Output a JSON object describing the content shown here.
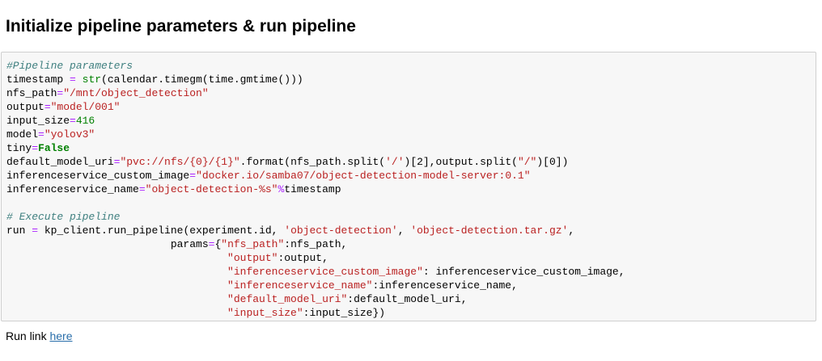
{
  "heading": "Initialize pipeline parameters & run pipeline",
  "code_cell": {
    "lines": [
      [
        {
          "t": "#Pipeline parameters",
          "k": "comment"
        }
      ],
      [
        {
          "t": "timestamp ",
          "k": "plain"
        },
        {
          "t": "=",
          "k": "op"
        },
        {
          "t": " ",
          "k": "plain"
        },
        {
          "t": "str",
          "k": "builtin"
        },
        {
          "t": "(calendar.timegm(time.gmtime()))",
          "k": "plain"
        }
      ],
      [
        {
          "t": "nfs_path",
          "k": "plain"
        },
        {
          "t": "=",
          "k": "op"
        },
        {
          "t": "\"/mnt/object_detection\"",
          "k": "string"
        }
      ],
      [
        {
          "t": "output",
          "k": "plain"
        },
        {
          "t": "=",
          "k": "op"
        },
        {
          "t": "\"model/001\"",
          "k": "string"
        }
      ],
      [
        {
          "t": "input_size",
          "k": "plain"
        },
        {
          "t": "=",
          "k": "op"
        },
        {
          "t": "416",
          "k": "number"
        }
      ],
      [
        {
          "t": "model",
          "k": "plain"
        },
        {
          "t": "=",
          "k": "op"
        },
        {
          "t": "\"yolov3\"",
          "k": "string"
        }
      ],
      [
        {
          "t": "tiny",
          "k": "plain"
        },
        {
          "t": "=",
          "k": "op"
        },
        {
          "t": "False",
          "k": "keyword"
        }
      ],
      [
        {
          "t": "default_model_uri",
          "k": "plain"
        },
        {
          "t": "=",
          "k": "op"
        },
        {
          "t": "\"pvc://nfs/{0}/{1}\"",
          "k": "string"
        },
        {
          "t": ".format(nfs_path.split(",
          "k": "plain"
        },
        {
          "t": "'/'",
          "k": "string"
        },
        {
          "t": ")[2],output.split(",
          "k": "plain"
        },
        {
          "t": "\"/\"",
          "k": "string"
        },
        {
          "t": ")[0])",
          "k": "plain"
        }
      ],
      [
        {
          "t": "inferenceservice_custom_image",
          "k": "plain"
        },
        {
          "t": "=",
          "k": "op"
        },
        {
          "t": "\"docker.io/samba07/object-detection-model-server:0.1\"",
          "k": "string"
        }
      ],
      [
        {
          "t": "inferenceservice_name",
          "k": "plain"
        },
        {
          "t": "=",
          "k": "op"
        },
        {
          "t": "\"object-detection-%s\"",
          "k": "string"
        },
        {
          "t": "%",
          "k": "op"
        },
        {
          "t": "timestamp",
          "k": "plain"
        }
      ],
      [],
      [
        {
          "t": "# Execute pipeline",
          "k": "comment"
        }
      ],
      [
        {
          "t": "run ",
          "k": "plain"
        },
        {
          "t": "=",
          "k": "op"
        },
        {
          "t": " kp_client.run_pipeline(experiment.id, ",
          "k": "plain"
        },
        {
          "t": "'object-detection'",
          "k": "string"
        },
        {
          "t": ", ",
          "k": "plain"
        },
        {
          "t": "'object-detection.tar.gz'",
          "k": "string"
        },
        {
          "t": ",",
          "k": "plain"
        }
      ],
      [
        {
          "t": "                          params",
          "k": "plain"
        },
        {
          "t": "=",
          "k": "op"
        },
        {
          "t": "{",
          "k": "plain"
        },
        {
          "t": "\"nfs_path\"",
          "k": "string"
        },
        {
          "t": ":nfs_path,",
          "k": "plain"
        }
      ],
      [
        {
          "t": "                                   ",
          "k": "plain"
        },
        {
          "t": "\"output\"",
          "k": "string"
        },
        {
          "t": ":output,",
          "k": "plain"
        }
      ],
      [
        {
          "t": "                                   ",
          "k": "plain"
        },
        {
          "t": "\"inferenceservice_custom_image\"",
          "k": "string"
        },
        {
          "t": ": inferenceservice_custom_image,",
          "k": "plain"
        }
      ],
      [
        {
          "t": "                                   ",
          "k": "plain"
        },
        {
          "t": "\"inferenceservice_name\"",
          "k": "string"
        },
        {
          "t": ":inferenceservice_name,",
          "k": "plain"
        }
      ],
      [
        {
          "t": "                                   ",
          "k": "plain"
        },
        {
          "t": "\"default_model_uri\"",
          "k": "string"
        },
        {
          "t": ":default_model_uri,",
          "k": "plain"
        }
      ],
      [
        {
          "t": "                                   ",
          "k": "plain"
        },
        {
          "t": "\"input_size\"",
          "k": "string"
        },
        {
          "t": ":input_size})",
          "k": "plain"
        }
      ]
    ]
  },
  "run_link": {
    "prefix": "Run link ",
    "link_text": "here"
  },
  "colors": {
    "comment": "#408080",
    "string": "#ba2121",
    "number": "#008000",
    "keyword": "#008000",
    "builtin": "#008000",
    "operator": "#aa22ff",
    "link": "#296eaa",
    "cell_background": "#f7f7f7",
    "cell_border": "#cfcfcf"
  }
}
